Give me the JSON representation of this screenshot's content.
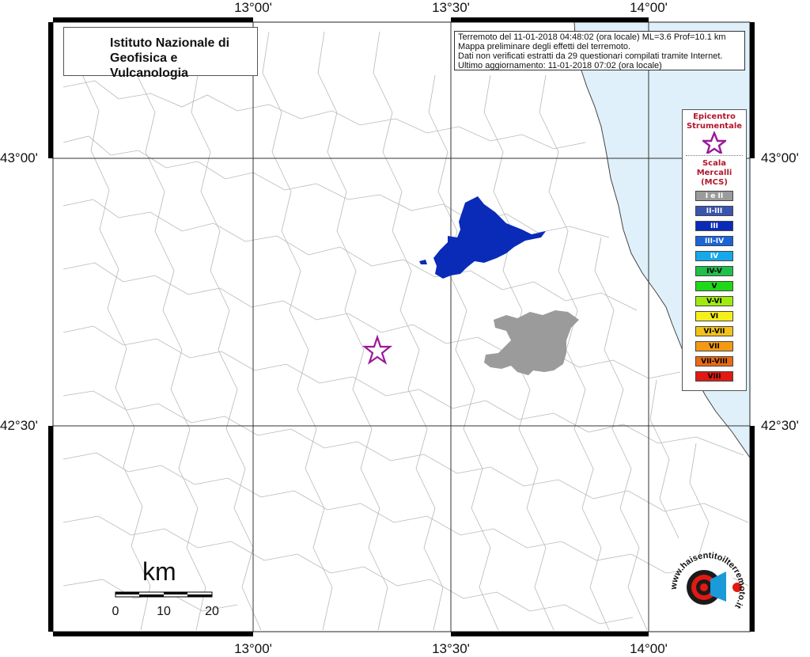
{
  "map": {
    "longitude_labels": [
      "13°00'",
      "13°30'",
      "14°00'"
    ],
    "latitude_labels": [
      "43°00'",
      "42°30'"
    ],
    "sea_color": "#dff0fa"
  },
  "logo": {
    "icon": "ingv-globe-icon",
    "line1": "Istituto Nazionale di",
    "line2": "Geofisica e Vulcanologia"
  },
  "info": {
    "line1": "Terremoto del 11-01-2018 04:48:02 (ora locale) ML=3.6 Prof=10.1 km",
    "line2": "Mappa preliminare degli effetti del terremoto.",
    "line3": "Dati non verificati estratti da 29 questionari compilati tramite Internet.",
    "line4": "Ultimo aggiornamento: 11-01-2018 07:02 (ora locale)"
  },
  "legend": {
    "epicenter_title_1": "Epicentro",
    "epicenter_title_2": "Strumentale",
    "epicenter_icon": "star-icon",
    "scale_title_1": "Scala",
    "scale_title_2": "Mercalli",
    "scale_title_3": "(MCS)",
    "classes": [
      {
        "label": "I e II",
        "color": "#9b9b9b",
        "text_color": "#ffffff"
      },
      {
        "label": "II-III",
        "color": "#3a55b0",
        "text_color": "#ffffff"
      },
      {
        "label": "III",
        "color": "#0a2bb8",
        "text_color": "#ffffff"
      },
      {
        "label": "III-IV",
        "color": "#1a64d8",
        "text_color": "#ffffff"
      },
      {
        "label": "IV",
        "color": "#16a8ea",
        "text_color": "#ffffff"
      },
      {
        "label": "IV-V",
        "color": "#1ec04a",
        "text_color": "#000000"
      },
      {
        "label": "V",
        "color": "#1fd817",
        "text_color": "#000000"
      },
      {
        "label": "V-VI",
        "color": "#a0ea12",
        "text_color": "#000000"
      },
      {
        "label": "VI",
        "color": "#f5f01a",
        "text_color": "#000000"
      },
      {
        "label": "VI-VII",
        "color": "#f3c21a",
        "text_color": "#000000"
      },
      {
        "label": "VII",
        "color": "#f39a12",
        "text_color": "#000000"
      },
      {
        "label": "VII-VIII",
        "color": "#ea6a14",
        "text_color": "#000000"
      },
      {
        "label": "VIII",
        "color": "#e01a12",
        "text_color": "#000000"
      }
    ]
  },
  "felt_areas": [
    {
      "intensity": "III",
      "color": "#0a2bb8"
    },
    {
      "intensity": "I e II",
      "color": "#9b9b9b"
    }
  ],
  "scale_bar": {
    "unit": "km",
    "labels": [
      "0",
      "10",
      "20"
    ]
  },
  "watermark": {
    "text": "www.haisentitoilterremoto.it",
    "icon": "haisentito-logo-icon"
  }
}
